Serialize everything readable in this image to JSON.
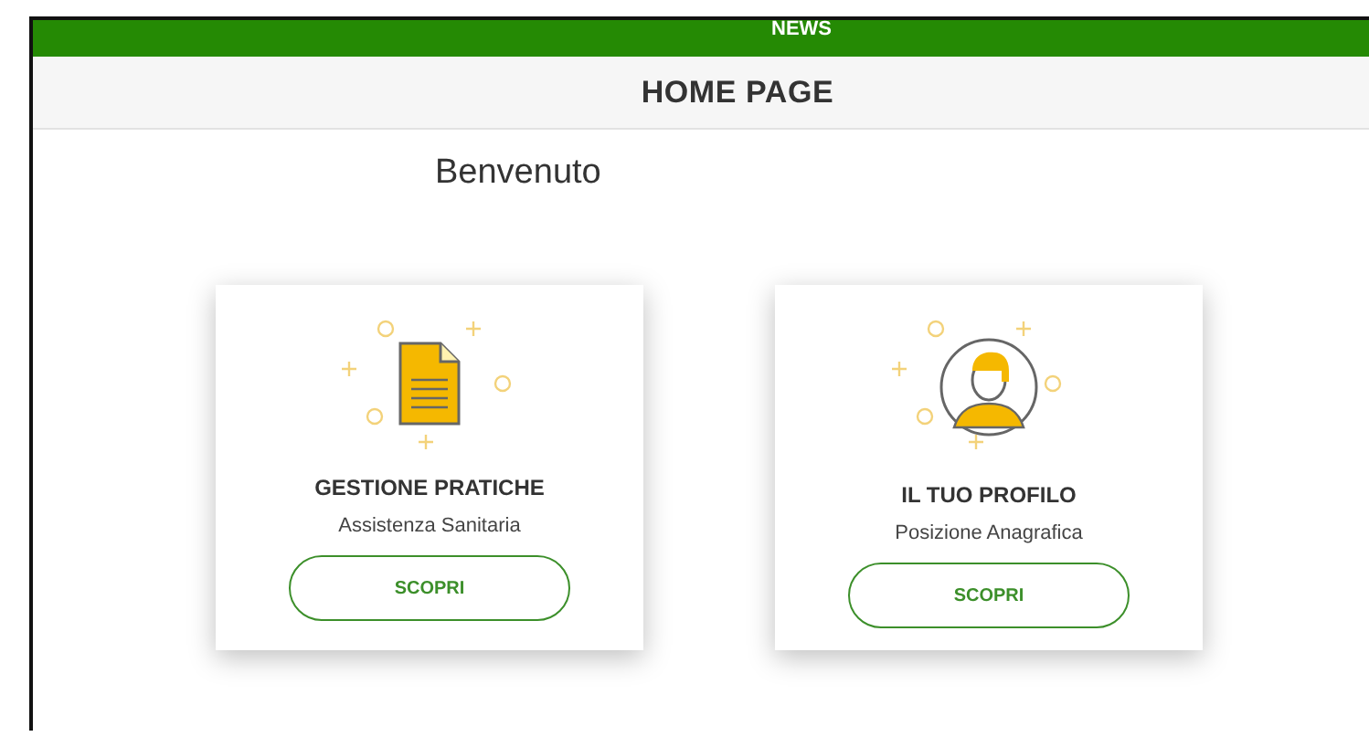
{
  "top_bar": {
    "label": "NEWS"
  },
  "header": {
    "title": "HOME PAGE"
  },
  "welcome": {
    "text": "Benvenuto"
  },
  "cards": [
    {
      "kind": "document",
      "title": "GESTIONE PRATICHE",
      "subtitle": "Assistenza Sanitaria",
      "button": "SCOPRI"
    },
    {
      "kind": "person",
      "title": "IL TUO PROFILO",
      "subtitle": "Posizione Anagrafica",
      "button": "SCOPRI"
    }
  ]
}
